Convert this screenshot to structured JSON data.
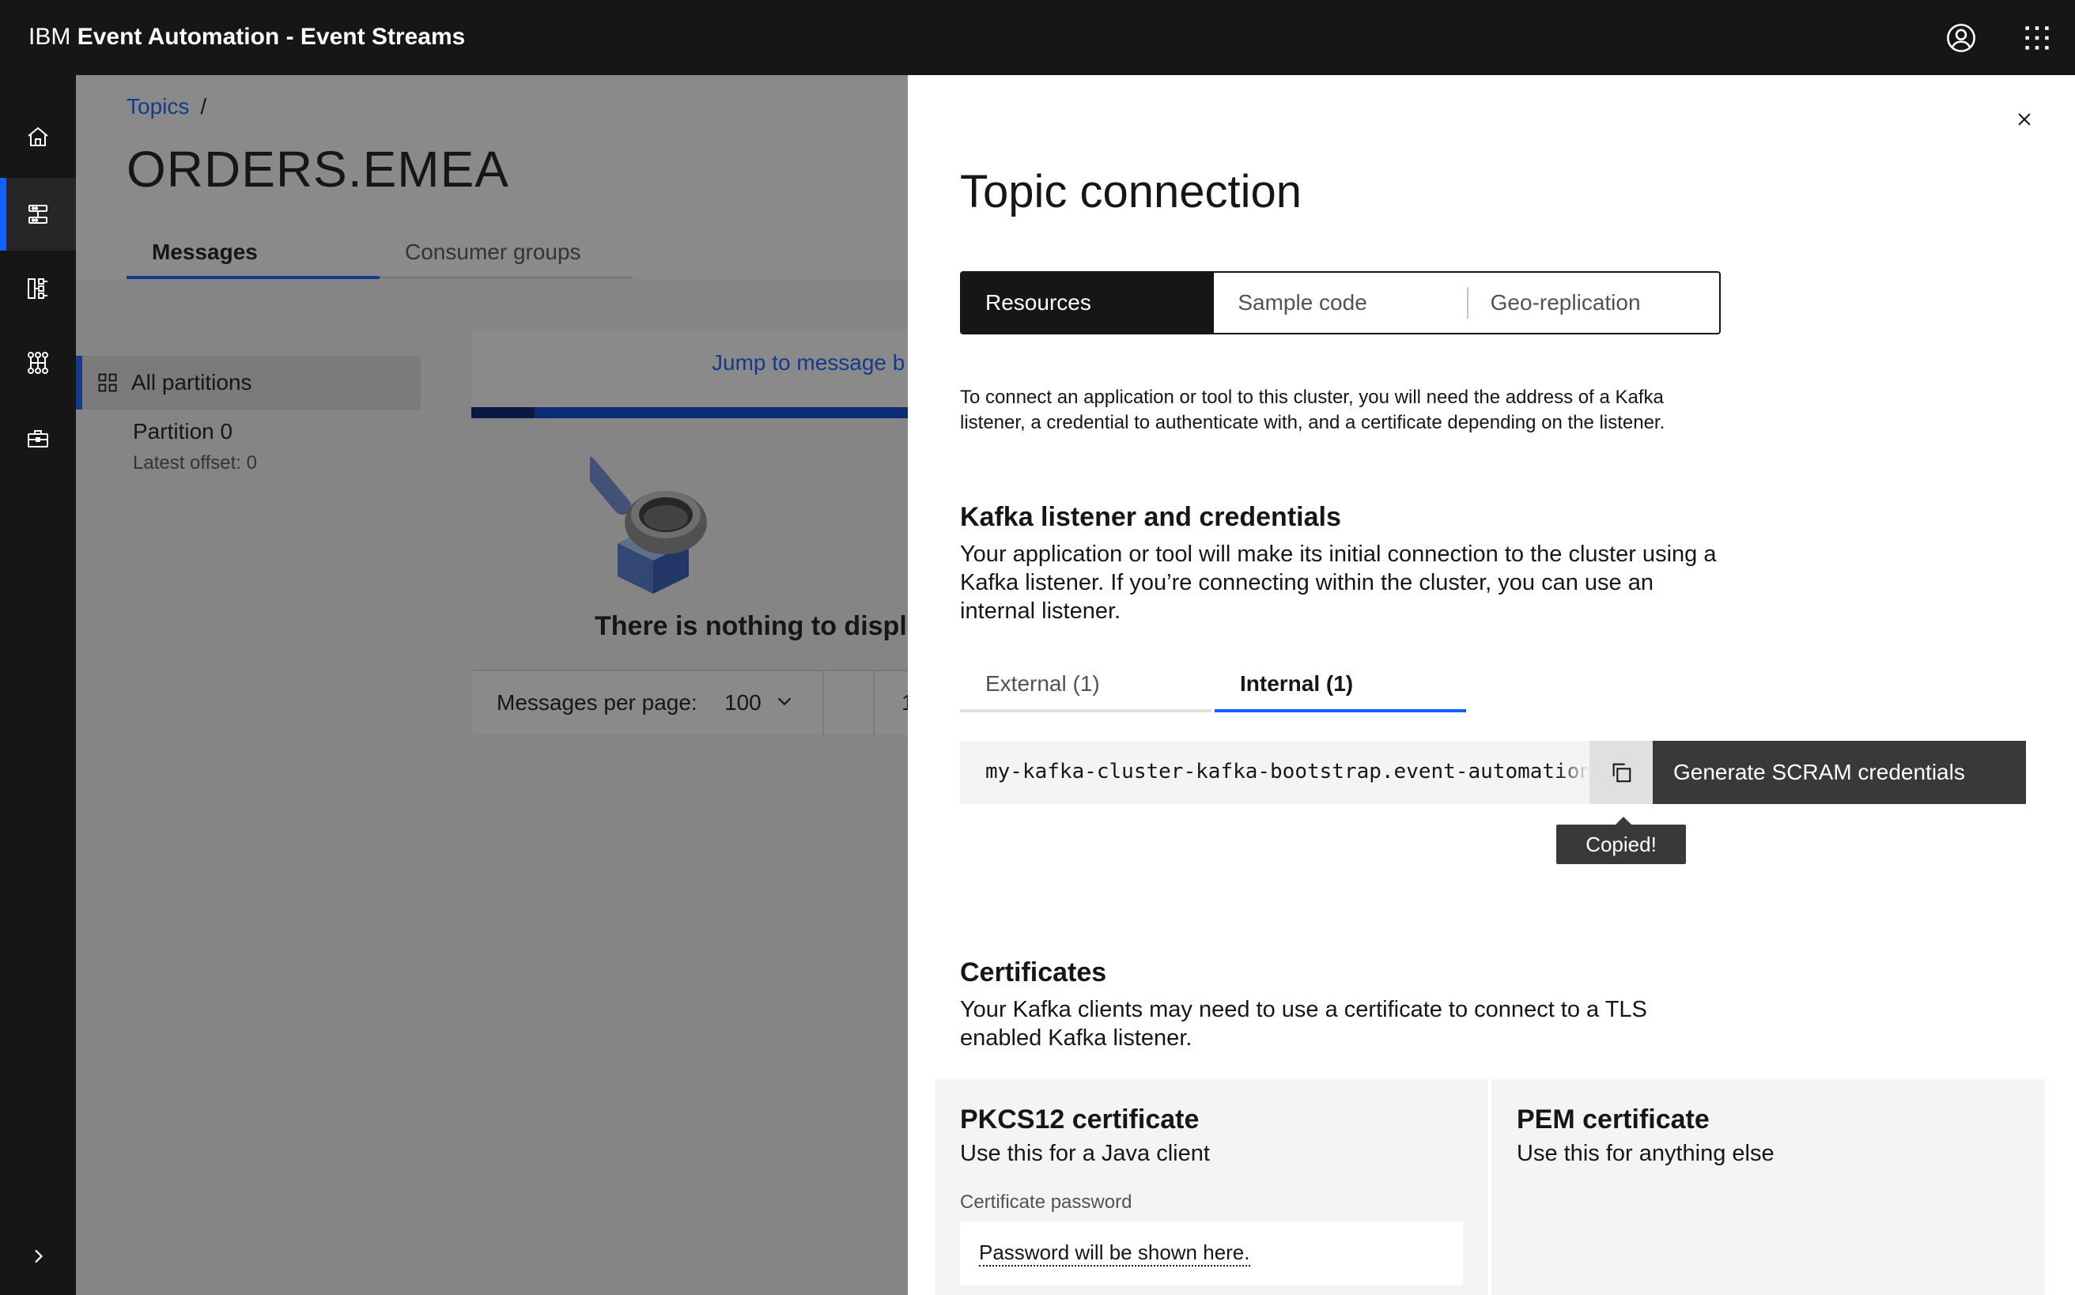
{
  "header": {
    "brand_prefix": "IBM",
    "brand_name": "Event Automation - Event Streams"
  },
  "icons": {
    "user": "user-avatar-icon",
    "switcher": "app-switcher-icon",
    "close": "close-icon",
    "copy": "copy-icon"
  },
  "rail": {
    "items": [
      "home-icon",
      "topics-icon",
      "schemas-icon",
      "consumer-groups-icon",
      "toolbox-icon"
    ],
    "expand": "chevron-right-icon"
  },
  "page": {
    "breadcrumb": {
      "topics": "Topics",
      "separator": "/"
    },
    "title": "ORDERS.EMEA",
    "tabs": [
      "Messages",
      "Consumer groups"
    ],
    "partitions": {
      "all": "All partitions",
      "p0_name": "Partition 0",
      "p0_offset": "Latest offset: 0"
    },
    "jump_link": "Jump to message b",
    "empty_text": "There is nothing to display",
    "pager": {
      "label": "Messages per page:",
      "value": "100",
      "page": "1"
    }
  },
  "panel": {
    "title": "Topic connection",
    "switcher": [
      "Resources",
      "Sample code",
      "Geo-replication"
    ],
    "intro": "To connect an application or tool to this cluster, you will need the address of a Kafka listener, a credential to authenticate with, and a certificate depending on the listener.",
    "kafka": {
      "heading": "Kafka listener and credentials",
      "description": "Your application or tool will make its initial connection to the cluster using a Kafka listener. If you’re connecting within the cluster, you can use an internal listener.",
      "tabs": [
        "External (1)",
        "Internal (1)"
      ],
      "address": "my-kafka-cluster-kafka-bootstrap.event-automation.s",
      "generate_button": "Generate SCRAM credentials",
      "tooltip": "Copied!"
    },
    "certificates": {
      "heading": "Certificates",
      "description": "Your Kafka clients may need to use a certificate to connect to a TLS enabled Kafka listener.",
      "pkcs12": {
        "title": "PKCS12 certificate",
        "subtitle": "Use this for a Java client",
        "password_label": "Certificate password",
        "password_placeholder": "Password will be shown here."
      },
      "pem": {
        "title": "PEM certificate",
        "subtitle": "Use this for anything else"
      }
    }
  },
  "colors": {
    "header_bg": "#161616",
    "accent": "#0f62fe",
    "panel_bg": "#ffffff",
    "overlay": "rgba(22,22,22,0.5)"
  }
}
